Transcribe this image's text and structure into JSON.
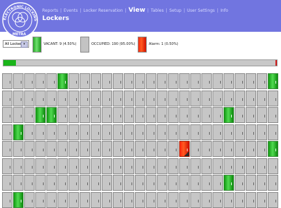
{
  "header": {
    "logo_text": "ELECTRONIC LOCKING — METRA",
    "nav": [
      {
        "label": "Reports",
        "active": false
      },
      {
        "label": "Events",
        "active": false
      },
      {
        "label": "Locker Reservation",
        "active": false
      },
      {
        "label": "View",
        "active": true
      },
      {
        "label": "Tables",
        "active": false
      },
      {
        "label": "Setup",
        "active": false
      },
      {
        "label": "User Settings",
        "active": false
      },
      {
        "label": "Info",
        "active": false
      }
    ],
    "page_title": "Lockers",
    "colors": {
      "bar": "#7175e0",
      "active": "#ffffff"
    }
  },
  "filter": {
    "selected": "All Lockers",
    "legend": {
      "vacant": "VACANT: 9 (4.50%)",
      "occupied": "OCCUPIED: 190 (95.00%)",
      "alarm": "Alarm: 1 (0.50%)"
    }
  },
  "summary": {
    "vacant_percent": 4.5,
    "occupied_percent": 95.0,
    "alarm_percent": 0.5,
    "colors": {
      "vacant": "#1ab51a",
      "occupied": "#c8c8c8",
      "alarm": "#d11a1a"
    }
  },
  "lockers": {
    "rows": [
      "OOOOOVOOOOOOOOOOOOOOOOOOV",
      "OOOOOOOOOOOOOOOOOOOOOOOOO",
      "OOOVVOOOOOOOOOOOOOOOVOOOO",
      "OVOOOOOOOOOOOOOOOOOOOOOOO",
      "OOOOOOOOOOOOOOOOAOOOOOOOV",
      "OOOOOOOOOOOOOOOOOOOOOOOOO",
      "OOOOOOOOOOOOOOOOOOOOVOOOO",
      "OVOOOOOOOOOOOOOOOOOOOOOOO"
    ],
    "legend": {
      "O": "occupied",
      "V": "vacant",
      "A": "alarm"
    }
  }
}
